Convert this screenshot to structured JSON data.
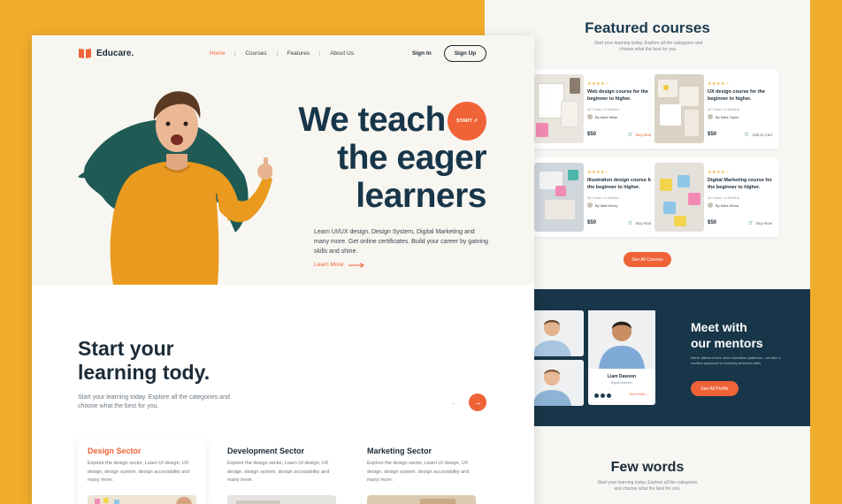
{
  "featured": {
    "title": "Featured courses",
    "subtitle": "Start your learning today. Explore all the categories and choose what the best for you.",
    "courses": [
      {
        "stars": "★★★★☆",
        "title": "Web design course for the beginner to higher.",
        "meta": "40 Class  •  3 Months",
        "author": "By Mark Milan",
        "price": "$50",
        "action": "Buy Now"
      },
      {
        "stars": "★★★★☆",
        "title": "UX design course for the beginner to higher.",
        "meta": "30 Class  •  2 Months",
        "author": "By Mark Taylor",
        "price": "$50",
        "action": "Add to Cart"
      },
      {
        "stars": "★★★★☆",
        "title": "Illustration design course for the beginner to higher.",
        "meta": "40 Class  •  3 Months",
        "author": "By Matt Henry",
        "price": "$50",
        "action": "Buy Now"
      },
      {
        "stars": "★★★★☆",
        "title": "Digital Marketing course for the beginner to higher.",
        "meta": "44 Class  •  3 Months",
        "author": "By Mark Wood",
        "price": "$50",
        "action": "Buy Now"
      }
    ],
    "see_all": "See All Courses"
  },
  "mentors": {
    "title_line1": "Meet with",
    "title_line2": "our mentors",
    "description": "We're different from other education platforms - we take a creative approach to teaching technical skills.",
    "button": "See All Profile",
    "card_name": "Liam Dawson",
    "card_role": "Digital Marketer",
    "card_link": "View Profile →"
  },
  "few_words": {
    "title": "Few words",
    "subtitle": "Start your learning today. Explore all the categories and choose what the best for you."
  },
  "brand": {
    "name": "Educare."
  },
  "nav": {
    "home": "Home",
    "courses": "Courses",
    "features": "Features",
    "about": "About Us",
    "signin": "Sign In",
    "signup": "Sign Up"
  },
  "hero": {
    "line1": "We teach to",
    "line2": "the eager",
    "line3": "learners",
    "start": "START ↗",
    "description": "Learn UI/UX design, Design System, Digital Marketing and many more. Get online certificates. Build your career by gaining skills and shine.",
    "learn_more": "Learn More"
  },
  "start_section": {
    "title_line1": "Start your",
    "title_line2": "learning tody.",
    "subtitle": "Start your learning today. Explore all the categories and choose what the best for you.",
    "prev_icon": "arrow-left-icon",
    "next_icon": "arrow-right-icon"
  },
  "sectors": [
    {
      "title": "Design Sector",
      "description": "Explore the design sector, Learn UI design, UX design, design system, design accessibility and many more."
    },
    {
      "title": "Development Sector",
      "description": "Explore the design sector, Learn UI design, UX design, design system, design accessibility and many more."
    },
    {
      "title": "Marketing Sector",
      "description": "Explore the design sector, Learn UI design, UX design, design system, design accessibility and many more."
    }
  ],
  "colors": {
    "accent": "#ef6337",
    "dark": "#183649",
    "background": "#f0ac2b",
    "hero_bg": "#f8f6f1"
  }
}
